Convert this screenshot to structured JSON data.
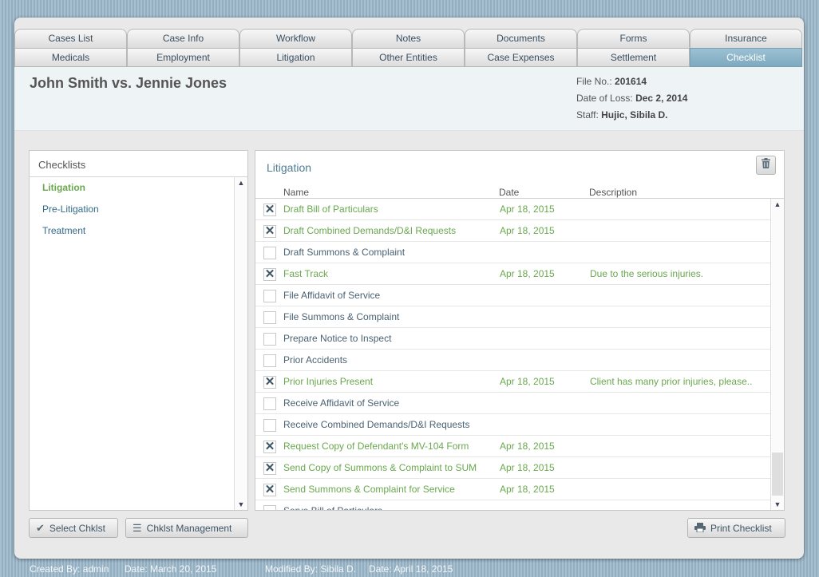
{
  "tabs_row1": [
    "Cases List",
    "Case Info",
    "Workflow",
    "Notes",
    "Documents",
    "Forms",
    "Insurance"
  ],
  "tabs_row2": [
    "Medicals",
    "Employment",
    "Litigation",
    "Other Entities",
    "Case Expenses",
    "Settlement",
    "Checklist"
  ],
  "active_tab": "Checklist",
  "case": {
    "title": "John Smith vs. Jennie Jones",
    "file_no_label": "File No.:",
    "file_no": "201614",
    "date_of_loss_label": "Date of Loss:",
    "date_of_loss": "Dec 2, 2014",
    "staff_label": "Staff:",
    "staff": "Hujic, Sibila D."
  },
  "checklists": {
    "title": "Checklists",
    "items": [
      {
        "label": "Litigation",
        "active": true
      },
      {
        "label": "Pre-Litigation",
        "active": false
      },
      {
        "label": "Treatment",
        "active": false
      }
    ]
  },
  "checklist_detail": {
    "title": "Litigation",
    "trash_icon": "trash-icon",
    "columns": {
      "name": "Name",
      "date": "Date",
      "description": "Description"
    },
    "rows": [
      {
        "checked": true,
        "name": "Draft Bill of Particulars",
        "date": "Apr 18, 2015",
        "description": ""
      },
      {
        "checked": true,
        "name": "Draft Combined Demands/D&I Requests",
        "date": "Apr 18, 2015",
        "description": ""
      },
      {
        "checked": false,
        "name": "Draft Summons & Complaint",
        "date": "",
        "description": ""
      },
      {
        "checked": true,
        "name": "Fast Track",
        "date": "Apr 18, 2015",
        "description": "Due to the serious injuries."
      },
      {
        "checked": false,
        "name": "File Affidavit of Service",
        "date": "",
        "description": ""
      },
      {
        "checked": false,
        "name": "File Summons & Complaint",
        "date": "",
        "description": ""
      },
      {
        "checked": false,
        "name": "Prepare Notice to Inspect",
        "date": "",
        "description": ""
      },
      {
        "checked": false,
        "name": "Prior Accidents",
        "date": "",
        "description": ""
      },
      {
        "checked": true,
        "name": "Prior Injuries Present",
        "date": "Apr 18, 2015",
        "description": "Client has many prior injuries, please.."
      },
      {
        "checked": false,
        "name": "Receive Affidavit of Service",
        "date": "",
        "description": ""
      },
      {
        "checked": false,
        "name": "Receive Combined Demands/D&I Requests",
        "date": "",
        "description": ""
      },
      {
        "checked": true,
        "name": "Request Copy of Defendant's MV-104 Form",
        "date": "Apr 18, 2015",
        "description": ""
      },
      {
        "checked": true,
        "name": "Send Copy of Summons & Complaint to SUM",
        "date": "Apr 18, 2015",
        "description": ""
      },
      {
        "checked": true,
        "name": "Send Summons & Complaint for Service",
        "date": "Apr 18, 2015",
        "description": ""
      },
      {
        "checked": false,
        "name": "Serve Bill of Particulars",
        "date": "",
        "description": ""
      }
    ]
  },
  "buttons": {
    "select": "Select Chklst",
    "management": "Chklst Management",
    "print": "Print Checklist"
  },
  "footer": {
    "created_by": "Created By: admin",
    "created_date": "Date: March 20, 2015",
    "modified_by": "Modified By: Sibila D.",
    "modified_date": "Date: April 18, 2015"
  },
  "colors": {
    "accent": "#6aa84f",
    "link": "#336b88",
    "active_tab": "#8db3c7"
  }
}
